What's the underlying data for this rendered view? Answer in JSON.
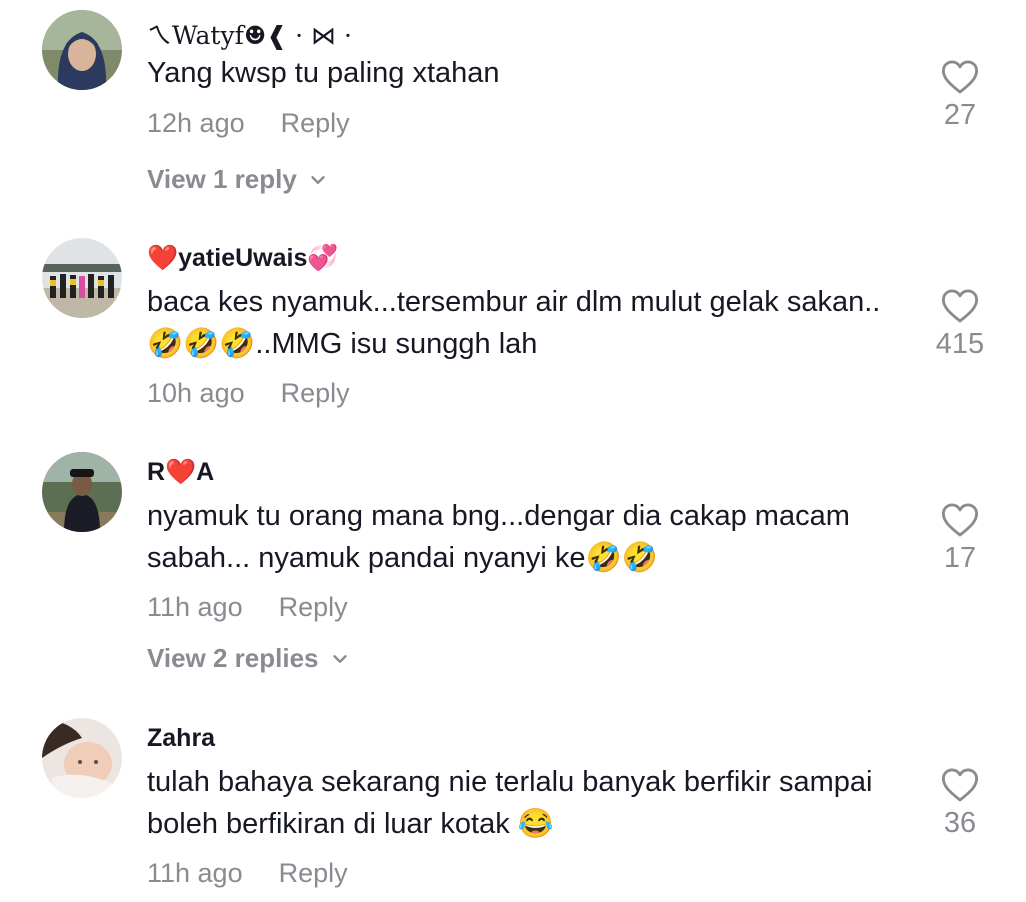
{
  "comments": [
    {
      "username": "ㄟWatyf☻❰ · ⋈ ·",
      "text": "Yang kwsp tu paling xtahan",
      "time": "12h ago",
      "reply_label": "Reply",
      "likes": "27",
      "view_replies": "View 1 reply"
    },
    {
      "username": "❤️yatieUwais💞",
      "text": "baca kes nyamuk...tersembur air dlm mulut gelak sakan..🤣🤣🤣..MMG isu sunggh lah",
      "time": "10h ago",
      "reply_label": "Reply",
      "likes": "415"
    },
    {
      "username": "R❤️A",
      "text": "nyamuk tu orang mana bng...dengar dia cakap macam sabah... nyamuk pandai nyanyi ke🤣🤣",
      "time": "11h ago",
      "reply_label": "Reply",
      "likes": "17",
      "view_replies": "View 2 replies"
    },
    {
      "username": "Zahra",
      "text": "tulah bahaya sekarang nie terlalu banyak berfikir sampai boleh berfikiran di luar kotak 😂",
      "time": "11h ago",
      "reply_label": "Reply",
      "likes": "36"
    }
  ],
  "colors": {
    "text": "#161823",
    "secondary": "#8a8b91",
    "background": "#ffffff"
  }
}
